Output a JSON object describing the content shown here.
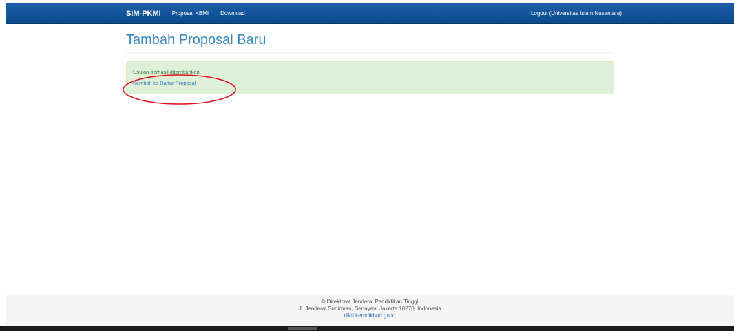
{
  "navbar": {
    "brand": "SIM-PKMI",
    "links": [
      "Proposal KBMI",
      "Download"
    ],
    "logout": "Logout (Universitas Islam Nusantara)"
  },
  "main": {
    "title": "Tambah Proposal Baru",
    "alert": {
      "message": "Usulan berhasil ditambahkan",
      "link": "Kembali ke Daftar Proposal"
    }
  },
  "footer": {
    "copyright": "© Direktorat Jenderal Pendidikan Tinggi",
    "address": "Jl. Jenderal Sudirman, Senayan, Jakarta 10270, Indonesia",
    "link": "dikti.kemdikbud.go.id"
  },
  "colors": {
    "navbar": "#0b4a8f",
    "title": "#3a8ac0",
    "alert_bg": "#dff0d8",
    "annotation": "#d9141c"
  }
}
